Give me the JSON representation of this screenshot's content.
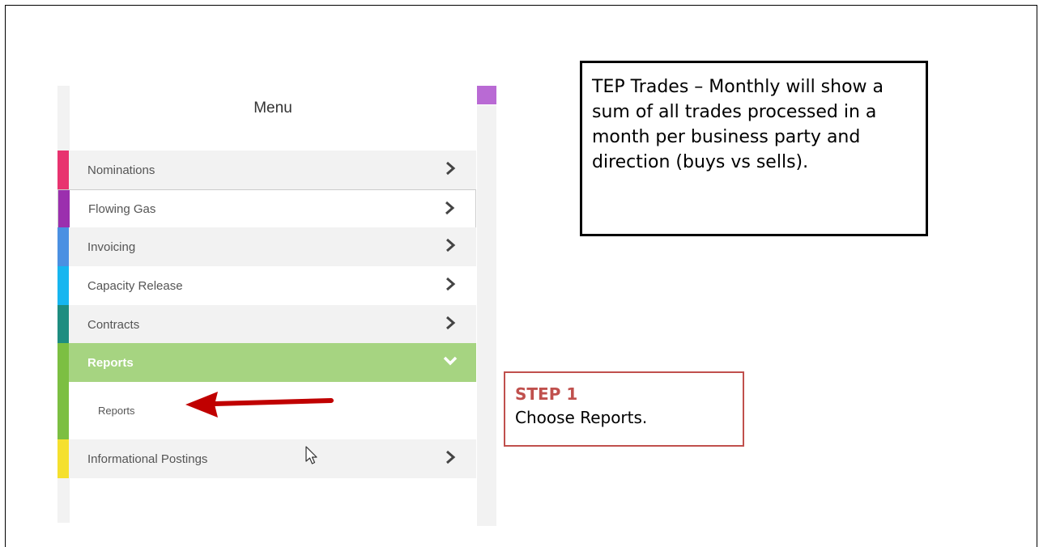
{
  "menu": {
    "title": "Menu",
    "items": [
      {
        "label": "Nominations",
        "color": "#e8336f"
      },
      {
        "label": "Flowing Gas",
        "color": "#9b2fae"
      },
      {
        "label": "Invoicing",
        "color": "#4a90e2"
      },
      {
        "label": "Capacity Release",
        "color": "#16b6f0"
      },
      {
        "label": "Contracts",
        "color": "#1e8d80"
      },
      {
        "label": "Reports",
        "color": "#7cbf42"
      },
      {
        "label": "Informational Postings",
        "color": "#f5e02e"
      }
    ],
    "submenu": [
      {
        "label": "Reports",
        "color": "#7cbf42"
      }
    ]
  },
  "callouts": {
    "info": "TEP Trades – Monthly will show a sum of all trades processed in a month per business party and direction (buys vs sells).",
    "step_title": "STEP 1",
    "step_body": "Choose Reports."
  },
  "colors": {
    "accent_green": "#a6d481",
    "callout_red": "#c0504d",
    "pointer_arrow": "#c00000"
  },
  "icons": [
    "chevron-right-icon",
    "chevron-down-icon",
    "mouse-pointer-icon",
    "red-arrow"
  ]
}
